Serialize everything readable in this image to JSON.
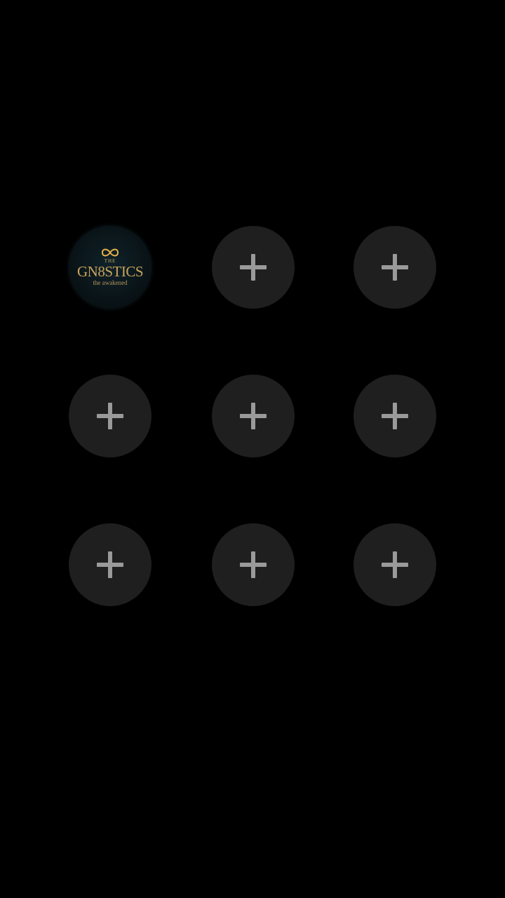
{
  "colors": {
    "background": "#000000",
    "slot_background": "#1f1f1f",
    "plus_color": "#9a9a9a",
    "logo_gold": "#c9a35c"
  },
  "grid": {
    "slots": [
      {
        "type": "logo",
        "logo": {
          "the": "THE",
          "name": "GN8STICS",
          "tagline": "the awakened",
          "icon": "infinity-icon"
        }
      },
      {
        "type": "add",
        "icon": "plus-icon"
      },
      {
        "type": "add",
        "icon": "plus-icon"
      },
      {
        "type": "add",
        "icon": "plus-icon"
      },
      {
        "type": "add",
        "icon": "plus-icon"
      },
      {
        "type": "add",
        "icon": "plus-icon"
      },
      {
        "type": "add",
        "icon": "plus-icon"
      },
      {
        "type": "add",
        "icon": "plus-icon"
      },
      {
        "type": "add",
        "icon": "plus-icon"
      }
    ]
  }
}
